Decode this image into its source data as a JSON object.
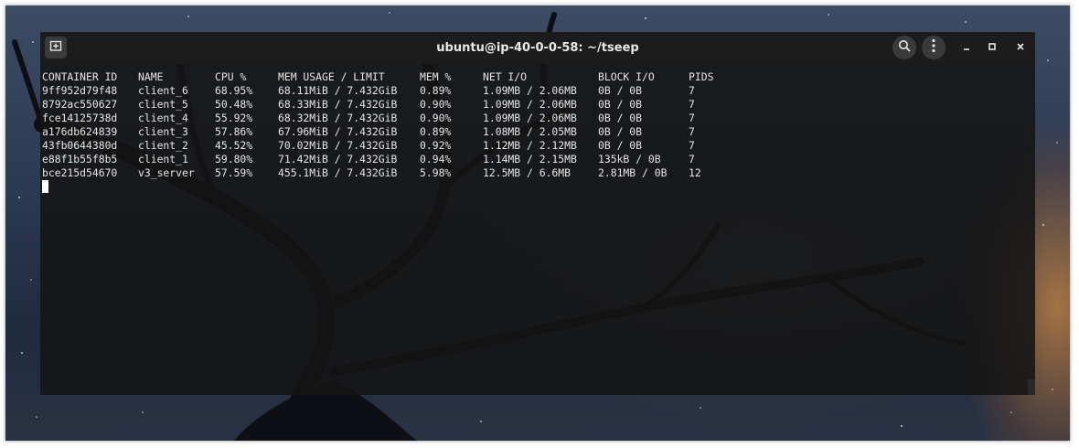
{
  "window": {
    "title": "ubuntu@ip-40-0-0-58: ~/tseep"
  },
  "icons": {
    "new_tab": "new-tab-icon",
    "search": "search-icon",
    "menu": "kebab-menu-icon",
    "minimize": "minimize-icon",
    "maximize": "maximize-icon",
    "close": "close-icon"
  },
  "colors": {
    "terminal_bg": "#141414",
    "titlebar_bg": "#1c1c1c",
    "text": "#e6e6e6"
  },
  "stats": {
    "headers": [
      "CONTAINER ID",
      "NAME",
      "CPU %",
      "MEM USAGE / LIMIT",
      "MEM %",
      "NET I/O",
      "BLOCK I/O",
      "PIDS"
    ],
    "rows": [
      [
        "9ff952d79f48",
        "client_6",
        "68.95%",
        "68.11MiB / 7.432GiB",
        "0.89%",
        "1.09MB / 2.06MB",
        "0B / 0B",
        "7"
      ],
      [
        "8792ac550627",
        "client_5",
        "50.48%",
        "68.33MiB / 7.432GiB",
        "0.90%",
        "1.09MB / 2.06MB",
        "0B / 0B",
        "7"
      ],
      [
        "fce14125738d",
        "client_4",
        "55.92%",
        "68.32MiB / 7.432GiB",
        "0.90%",
        "1.09MB / 2.06MB",
        "0B / 0B",
        "7"
      ],
      [
        "a176db624839",
        "client_3",
        "57.86%",
        "67.96MiB / 7.432GiB",
        "0.89%",
        "1.08MB / 2.05MB",
        "0B / 0B",
        "7"
      ],
      [
        "43fb0644380d",
        "client_2",
        "45.52%",
        "70.02MiB / 7.432GiB",
        "0.92%",
        "1.12MB / 2.12MB",
        "0B / 0B",
        "7"
      ],
      [
        "e88f1b55f8b5",
        "client_1",
        "59.80%",
        "71.42MiB / 7.432GiB",
        "0.94%",
        "1.14MB / 2.15MB",
        "135kB / 0B",
        "7"
      ],
      [
        "bce215d54670",
        "v3_server",
        "57.59%",
        "455.1MiB / 7.432GiB",
        "5.98%",
        "12.5MB / 6.6MB",
        "2.81MB / 0B",
        "12"
      ]
    ]
  }
}
